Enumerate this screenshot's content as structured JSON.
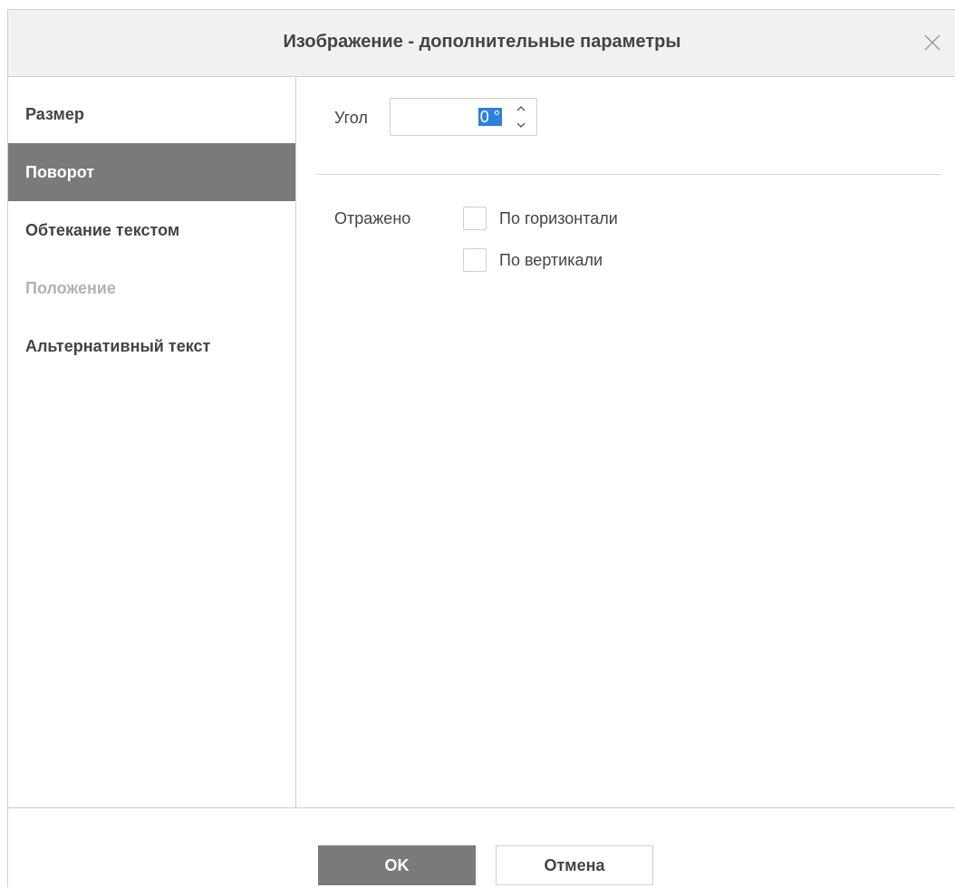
{
  "dialog": {
    "title": "Изображение - дополнительные параметры"
  },
  "sidebar": {
    "items": [
      {
        "label": "Размер",
        "state": "normal"
      },
      {
        "label": "Поворот",
        "state": "active"
      },
      {
        "label": "Обтекание текстом",
        "state": "normal"
      },
      {
        "label": "Положение",
        "state": "disabled"
      },
      {
        "label": "Альтернативный текст",
        "state": "normal"
      }
    ]
  },
  "rotation": {
    "angle_label": "Угол",
    "angle_value": "0 °",
    "flip_label": "Отражено",
    "horizontal_label": "По горизонтали",
    "horizontal_checked": false,
    "vertical_label": "По вертикали",
    "vertical_checked": false
  },
  "footer": {
    "ok_label": "OK",
    "cancel_label": "Отмена"
  },
  "colors": {
    "active_bg": "#7a7a7a",
    "header_bg": "#f1f1f1",
    "selection": "#2f7fe0",
    "disabled_text": "#b3b3b3"
  },
  "icons": {
    "close": "close-icon",
    "spin_up": "chevron-up-icon",
    "spin_down": "chevron-down-icon"
  }
}
